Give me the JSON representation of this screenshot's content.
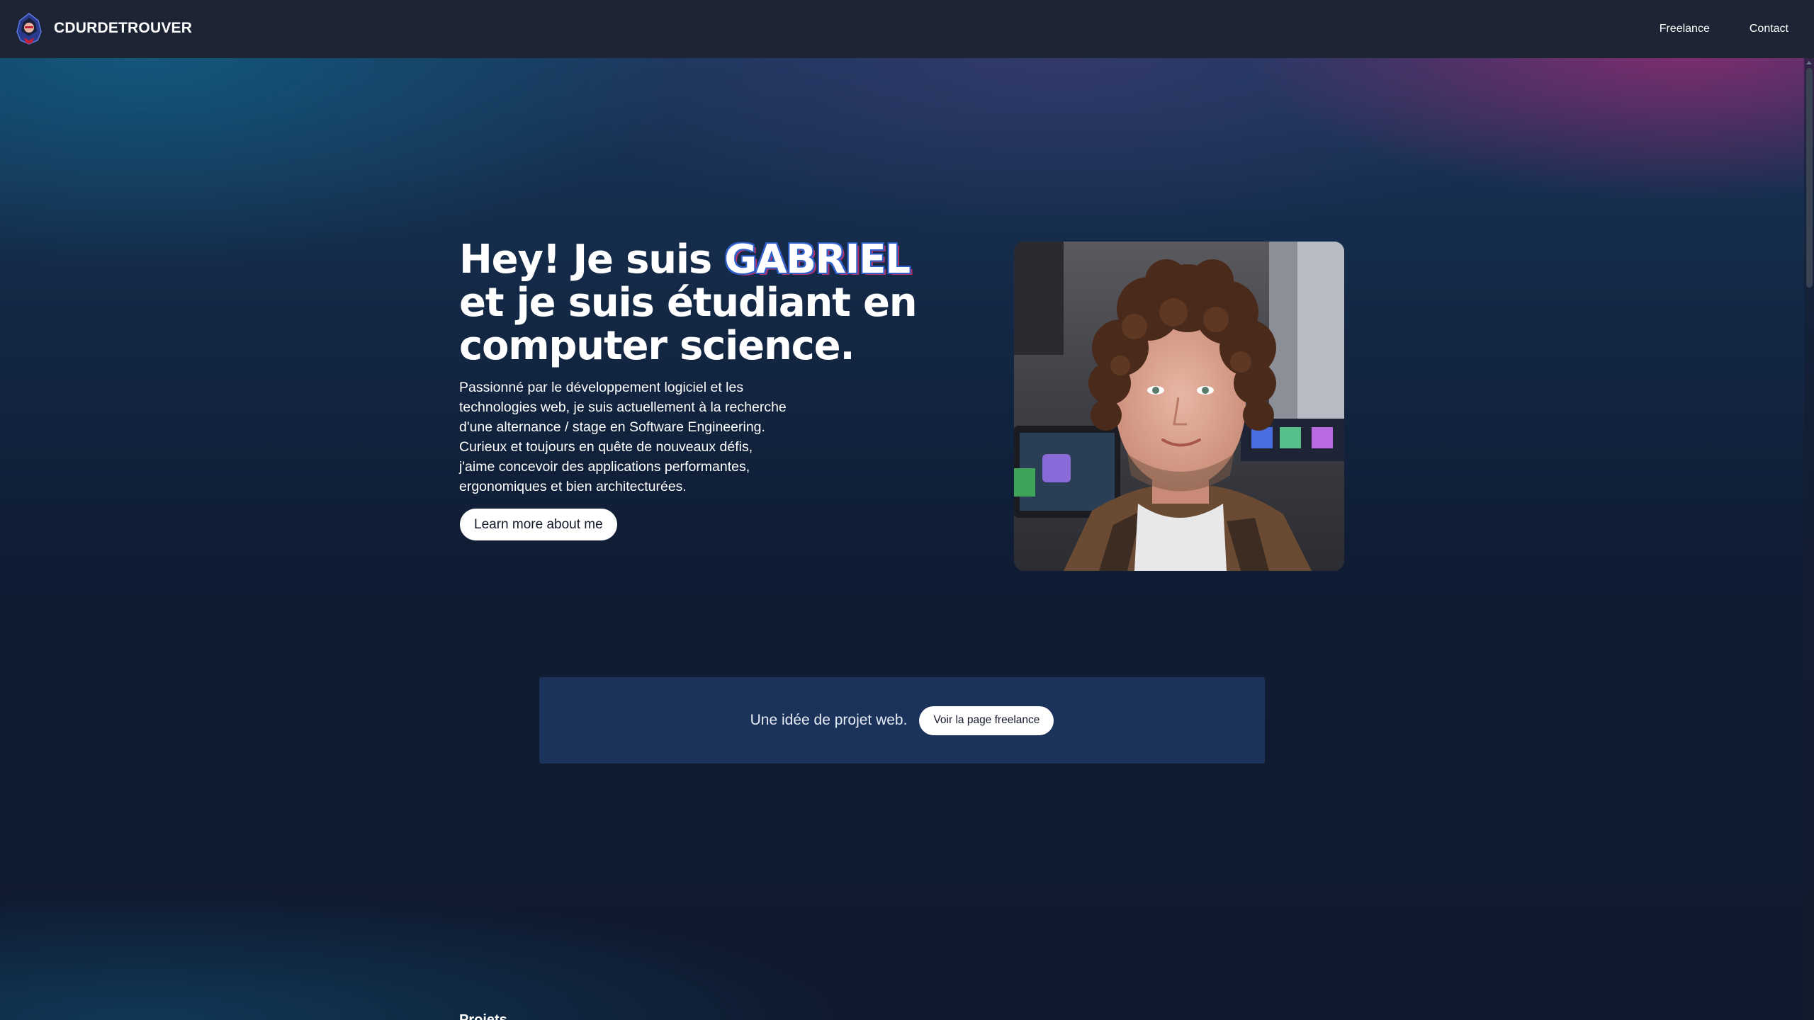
{
  "header": {
    "brand_name": "CDURDETROUVER",
    "nav": [
      {
        "label": "Freelance"
      },
      {
        "label": "Contact"
      }
    ]
  },
  "hero": {
    "title_line1_prefix": "Hey! Je suis ",
    "title_name": "GABRIEL",
    "title_line2": "et je suis étudiant en",
    "title_line3": "computer science.",
    "description_lines": [
      "Passionné par le développement logiciel et les",
      "technologies web, je suis actuellement à la recherche",
      "d'une alternance / stage en Software Engineering.",
      "Curieux et toujours en quête de nouveaux défis,",
      "j'aime concevoir des applications performantes,",
      "ergonomiques et bien architecturées."
    ],
    "cta_label": "Learn more about me"
  },
  "banner": {
    "text": "Une idée de projet web.",
    "button_label": "Voir la page freelance"
  },
  "next_section": {
    "heading": "Projets"
  },
  "colors": {
    "header_bg": "#1d2433",
    "banner_bg": "#1b335a",
    "name_outline": "#2f5fc8",
    "name_shadow": "#b0306a"
  },
  "icons": {
    "logo": "hooded-avatar-logo"
  }
}
